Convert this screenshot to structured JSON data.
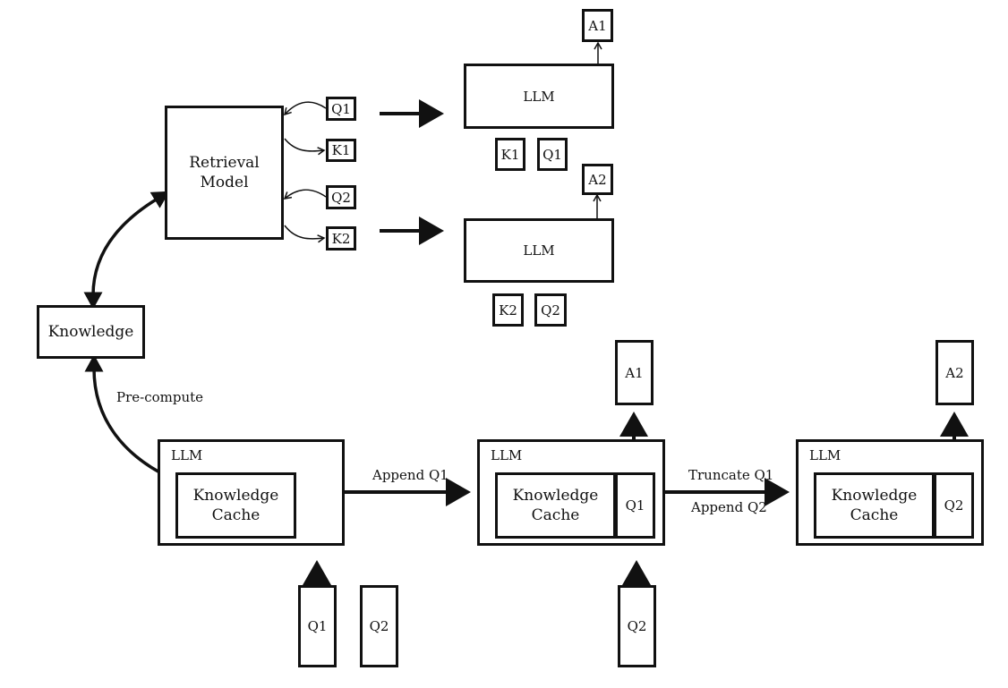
{
  "top": {
    "retrieval_model": "Retrieval\nModel",
    "retrieval_model_lines": [
      "Retrieval",
      "Model"
    ],
    "side_tokens": [
      "Q1",
      "K1",
      "Q2",
      "K2"
    ],
    "llm_rows": [
      {
        "label": "LLM",
        "inputs": [
          "K1",
          "Q1"
        ],
        "output": "A1"
      },
      {
        "label": "LLM",
        "inputs": [
          "K2",
          "Q2"
        ],
        "output": "A2"
      }
    ]
  },
  "knowledge": "Knowledge",
  "precompute_label": "Pre-compute",
  "bottom": {
    "stages": [
      {
        "llm_label": "LLM",
        "cache_lines": [
          "Knowledge",
          "Cache"
        ],
        "slot": null,
        "output": null
      },
      {
        "llm_label": "LLM",
        "cache_lines": [
          "Knowledge",
          "Cache"
        ],
        "slot": "Q1",
        "output": "A1"
      },
      {
        "llm_label": "LLM",
        "cache_lines": [
          "Knowledge",
          "Cache"
        ],
        "slot": "Q2",
        "output": "A2"
      }
    ],
    "transitions": [
      {
        "labels": [
          "Append Q1"
        ]
      },
      {
        "labels": [
          "Truncate Q1",
          "Append Q2"
        ]
      }
    ],
    "queue_first": [
      "Q1",
      "Q2"
    ],
    "queue_second": [
      "Q2"
    ]
  }
}
